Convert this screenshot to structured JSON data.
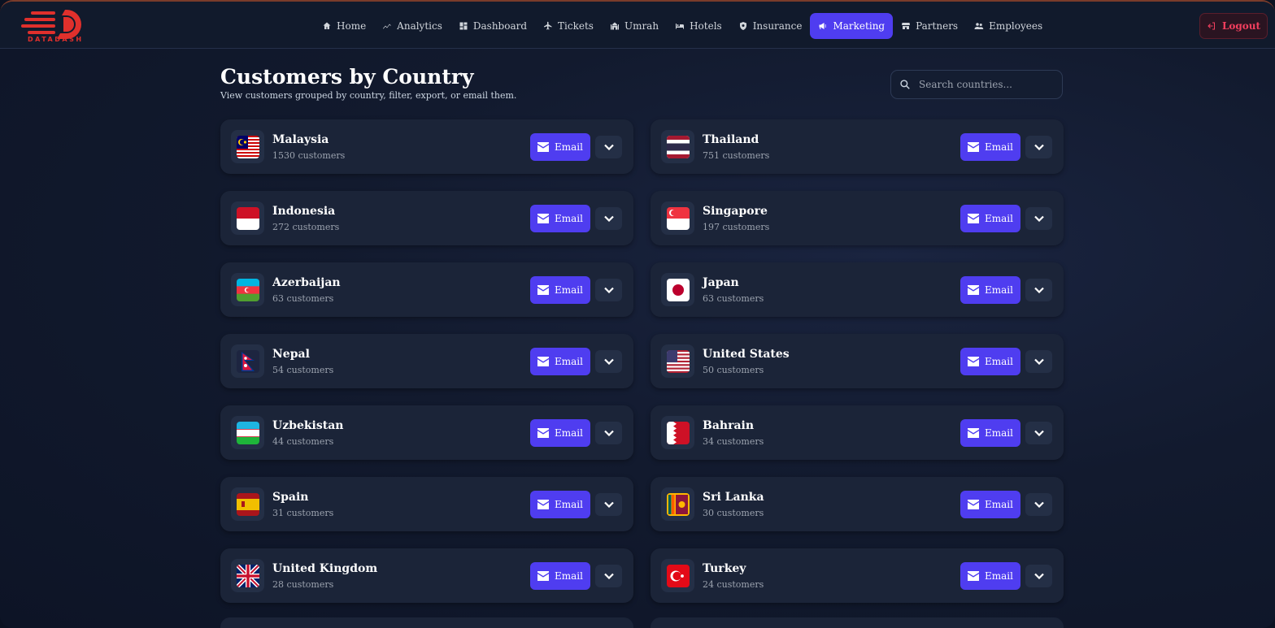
{
  "brand": {
    "name": "DATADASH",
    "color": "#e0302c"
  },
  "nav": {
    "items": [
      {
        "label": "Home",
        "icon": "home-icon"
      },
      {
        "label": "Analytics",
        "icon": "chart-line-icon"
      },
      {
        "label": "Dashboard",
        "icon": "grid-icon"
      },
      {
        "label": "Tickets",
        "icon": "plane-icon"
      },
      {
        "label": "Umrah",
        "icon": "mosque-icon"
      },
      {
        "label": "Hotels",
        "icon": "bed-icon"
      },
      {
        "label": "Insurance",
        "icon": "shield-icon"
      },
      {
        "label": "Marketing",
        "icon": "megaphone-icon",
        "active": true
      },
      {
        "label": "Partners",
        "icon": "store-icon"
      },
      {
        "label": "Employees",
        "icon": "users-icon"
      }
    ],
    "logout_label": "Logout"
  },
  "page": {
    "title": "Customers by Country",
    "subtitle": "View customers grouped by country, filter, export, or email them.",
    "search_placeholder": "Search countries..."
  },
  "email_label": "Email",
  "accent": "#4f3df0",
  "countries": [
    {
      "name": "Malaysia",
      "count": "1530 customers",
      "flag": "my"
    },
    {
      "name": "Thailand",
      "count": "751 customers",
      "flag": "th"
    },
    {
      "name": "Indonesia",
      "count": "272 customers",
      "flag": "id"
    },
    {
      "name": "Singapore",
      "count": "197 customers",
      "flag": "sg"
    },
    {
      "name": "Azerbaijan",
      "count": "63 customers",
      "flag": "az"
    },
    {
      "name": "Japan",
      "count": "63 customers",
      "flag": "jp"
    },
    {
      "name": "Nepal",
      "count": "54 customers",
      "flag": "np"
    },
    {
      "name": "United States",
      "count": "50 customers",
      "flag": "us"
    },
    {
      "name": "Uzbekistan",
      "count": "44 customers",
      "flag": "uz"
    },
    {
      "name": "Bahrain",
      "count": "34 customers",
      "flag": "bh"
    },
    {
      "name": "Spain",
      "count": "31 customers",
      "flag": "es"
    },
    {
      "name": "Sri Lanka",
      "count": "30 customers",
      "flag": "lk"
    },
    {
      "name": "United Kingdom",
      "count": "28 customers",
      "flag": "gb"
    },
    {
      "name": "Turkey",
      "count": "24 customers",
      "flag": "tr"
    }
  ]
}
